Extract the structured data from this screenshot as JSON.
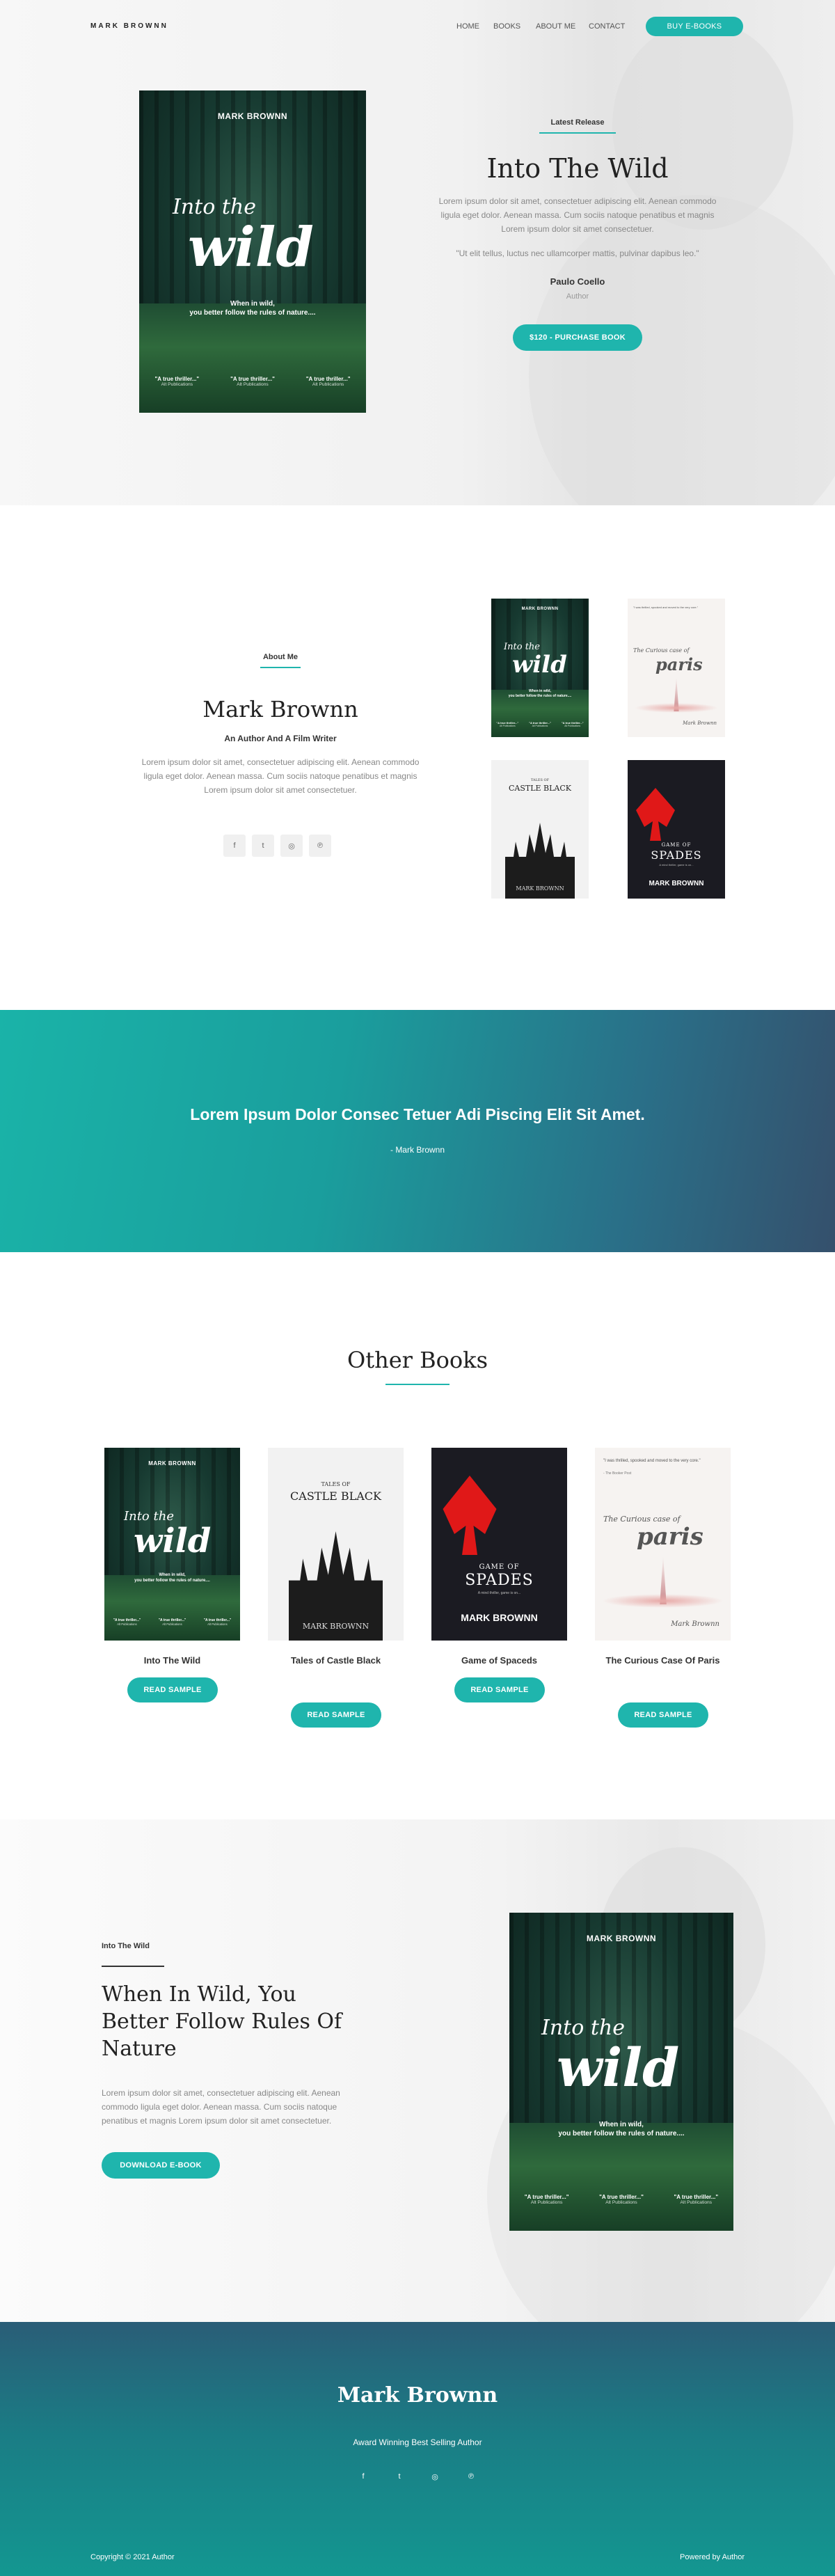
{
  "nav": {
    "logo": "MARK BROWNN",
    "items": [
      "HOME",
      "BOOKS",
      "ABOUT ME",
      "CONTACT"
    ],
    "cta": "BUY E-BOOKS"
  },
  "covers": {
    "wild": {
      "author": "MARK BROWNN",
      "into": "Into the",
      "wild": "wild",
      "tagline_1": "When in wild,",
      "tagline_2": "you better follow the rules of nature....",
      "quote": "\"A true thriller...\"",
      "publication": "Alt Publications"
    },
    "paris": {
      "top_quote": "\"I was thrilled, spooked and moved to the very core.\"",
      "top_source": "- The Booker Post",
      "title_1": "The Curious case of",
      "title_2": "paris",
      "author": "Mark Brownn"
    },
    "castle": {
      "title_1": "TALES OF",
      "title_2": "CASTLE BLACK",
      "author": "MARK BROWNN"
    },
    "spades": {
      "title_1": "GAME OF",
      "title_2": "SPADES",
      "sub": "A mind thriller, game is on...",
      "author": "MARK BROWNN"
    }
  },
  "hero": {
    "label": "Latest Release",
    "title": "Into The Wild",
    "description": "Lorem ipsum dolor sit amet, consectetuer adipiscing elit. Aenean commodo ligula eget dolor. Aenean massa. Cum sociis natoque penatibus et magnis Lorem ipsum dolor sit amet consectetuer.",
    "quote": "\"Ut elit tellus, luctus nec ullamcorper mattis, pulvinar dapibus leo.\"",
    "quote_author": "Paulo Coello",
    "quote_role": "Author",
    "button": "$120 - PURCHASE BOOK"
  },
  "about": {
    "label": "About Me",
    "name": "Mark Brownn",
    "subtitle": "An Author And A Film Writer",
    "description": "Lorem ipsum dolor sit amet, consectetuer adipiscing elit. Aenean commodo ligula eget dolor. Aenean massa. Cum sociis natoque penatibus et magnis Lorem ipsum dolor sit amet consectetuer.",
    "social_icons": [
      "facebook-icon",
      "twitter-icon",
      "instagram-icon",
      "pinterest-icon"
    ]
  },
  "quote_band": {
    "text": "Lorem Ipsum Dolor Consec Tetuer Adi Piscing Elit Sit Amet.",
    "author": "- Mark Brownn"
  },
  "other_books": {
    "title": "Other Books",
    "books": [
      {
        "title": "Into The Wild",
        "button": "READ SAMPLE"
      },
      {
        "title": "Tales of Castle Black",
        "button": "READ SAMPLE"
      },
      {
        "title": "Game of Spaceds",
        "button": "READ SAMPLE"
      },
      {
        "title": "The Curious Case Of Paris",
        "button": "READ SAMPLE"
      }
    ]
  },
  "feature": {
    "label": "Into The Wild",
    "heading_1": "When In Wild, You",
    "heading_2": "Better Follow Rules Of",
    "heading_3": "Nature",
    "description": "Lorem ipsum dolor sit amet, consectetuer adipiscing elit. Aenean commodo ligula eget dolor. Aenean massa. Cum sociis natoque penatibus et magnis Lorem ipsum dolor sit amet consectetuer.",
    "button": "DOWNLOAD E-BOOK"
  },
  "footer": {
    "name": "Mark Brownn",
    "tagline": "Award Winning Best Selling Author",
    "social_icons": [
      "facebook-icon",
      "twitter-icon",
      "instagram-icon",
      "pinterest-icon"
    ],
    "copyright": "Copyright © 2021 Author",
    "powered": "Powered by Author"
  },
  "colors": {
    "accent": "#1fb5ad",
    "dark": "#333333"
  }
}
